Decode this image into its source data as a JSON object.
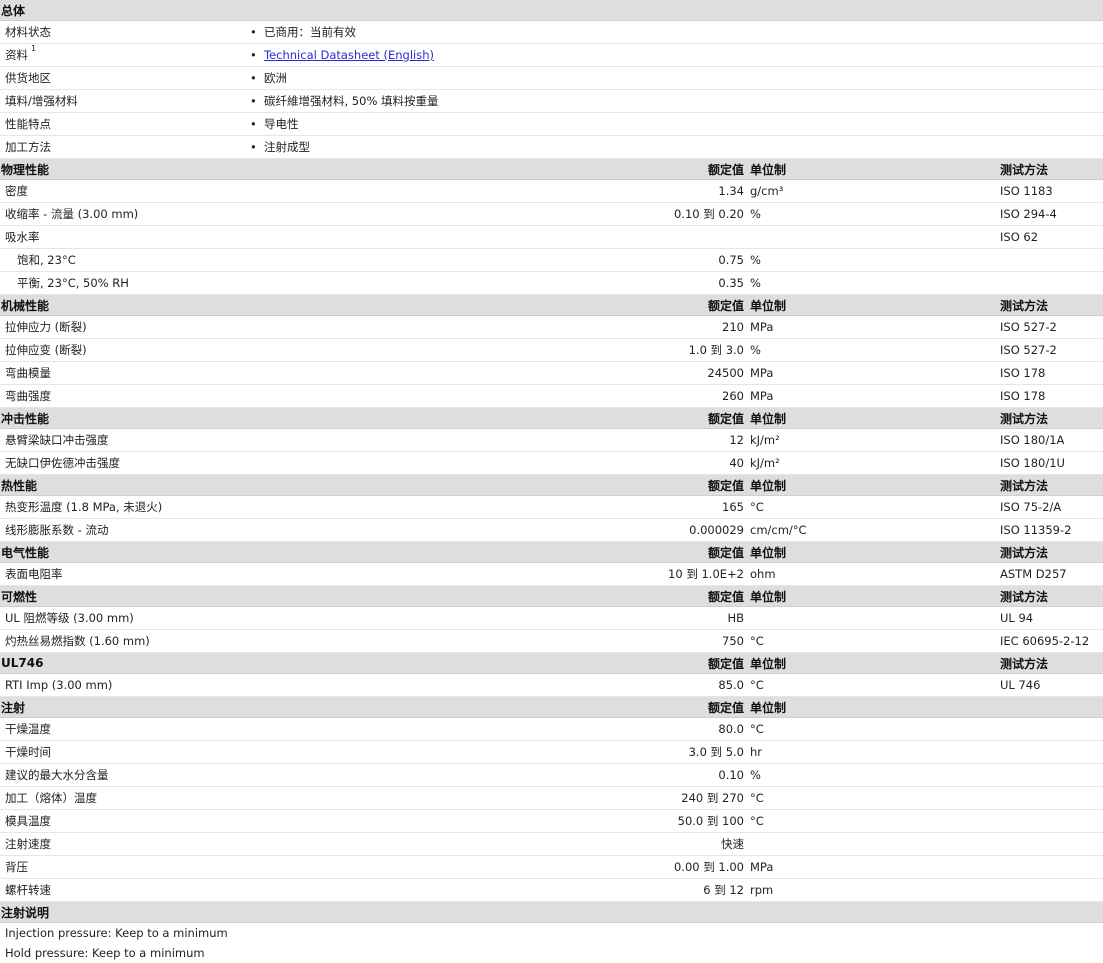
{
  "general": {
    "title": "总体",
    "rows": [
      {
        "label": "材料状态",
        "value": "已商用：当前有效"
      },
      {
        "label": "资料",
        "sup": "1",
        "value": "Technical Datasheet (English)",
        "link": true
      },
      {
        "label": "供货地区",
        "value": "欧洲"
      },
      {
        "label": "填料/增强材料",
        "value": "碳纤維增强材料, 50% 填料按重量"
      },
      {
        "label": "性能特点",
        "value": "导电性"
      },
      {
        "label": "加工方法",
        "value": "注射成型"
      }
    ],
    "bullet": "•"
  },
  "headers": {
    "nominal": "额定值",
    "unit": "单位制",
    "method": "测试方法"
  },
  "sections": [
    {
      "title": "物理性能",
      "show_method": true,
      "rows": [
        {
          "label": "密度",
          "value": "1.34",
          "unit": "g/cm³",
          "method": "ISO 1183"
        },
        {
          "label": "收缩率  - 流量  (3.00 mm)",
          "value": "0.10 到  0.20",
          "unit": "%",
          "method": "ISO 294-4"
        },
        {
          "label": "吸水率",
          "value": "",
          "unit": "",
          "method": "ISO 62"
        },
        {
          "label": "饱和, 23°C",
          "sub": true,
          "value": "0.75",
          "unit": "%",
          "method": ""
        },
        {
          "label": "平衡, 23°C, 50% RH",
          "sub": true,
          "value": "0.35",
          "unit": "%",
          "method": ""
        }
      ]
    },
    {
      "title": "机械性能",
      "show_method": true,
      "rows": [
        {
          "label": "拉伸应力  (断裂)",
          "value": "210",
          "unit": "MPa",
          "method": "ISO 527-2"
        },
        {
          "label": "拉伸应变  (断裂)",
          "value": "1.0 到  3.0",
          "unit": "%",
          "method": "ISO 527-2"
        },
        {
          "label": "弯曲模量",
          "value": "24500",
          "unit": "MPa",
          "method": "ISO 178"
        },
        {
          "label": "弯曲强度",
          "value": "260",
          "unit": "MPa",
          "method": "ISO 178"
        }
      ]
    },
    {
      "title": "冲击性能",
      "show_method": true,
      "rows": [
        {
          "label": "悬臂梁缺口冲击强度",
          "value": "12",
          "unit": "kJ/m²",
          "method": "ISO 180/1A"
        },
        {
          "label": "无缺口伊佐德冲击强度",
          "value": "40",
          "unit": "kJ/m²",
          "method": "ISO 180/1U"
        }
      ]
    },
    {
      "title": "热性能",
      "show_method": true,
      "rows": [
        {
          "label": "热变形温度  (1.8 MPa, 未退火)",
          "value": "165",
          "unit": "°C",
          "method": "ISO 75-2/A"
        },
        {
          "label": "线形膨胀系数  - 流动",
          "value": "0.000029",
          "unit": "cm/cm/°C",
          "method": "ISO 11359-2"
        }
      ]
    },
    {
      "title": "电气性能",
      "show_method": true,
      "rows": [
        {
          "label": "表面电阻率",
          "value": "10 到  1.0E+2",
          "unit": "ohm",
          "method": "ASTM D257"
        }
      ]
    },
    {
      "title": "可燃性",
      "show_method": true,
      "rows": [
        {
          "label": "UL 阻燃等级  (3.00 mm)",
          "value": "HB",
          "unit": "",
          "method": "UL 94"
        },
        {
          "label": "灼热丝易燃指数  (1.60 mm)",
          "value": "750",
          "unit": "°C",
          "method": "IEC 60695-2-12"
        }
      ]
    },
    {
      "title": "UL746",
      "show_method": true,
      "rows": [
        {
          "label": "RTI Imp (3.00 mm)",
          "value": "85.0",
          "unit": "°C",
          "method": "UL 746"
        }
      ]
    },
    {
      "title": "注射",
      "show_method": false,
      "rows": [
        {
          "label": "干燥温度",
          "value": "80.0",
          "unit": "°C",
          "method": ""
        },
        {
          "label": "干燥时间",
          "value": "3.0 到  5.0",
          "unit": "hr",
          "method": ""
        },
        {
          "label": "建议的最大水分含量",
          "value": "0.10",
          "unit": "%",
          "method": ""
        },
        {
          "label": "加工（熔体）温度",
          "value": "240 到  270",
          "unit": "°C",
          "method": ""
        },
        {
          "label": "模具温度",
          "value": "50.0 到  100",
          "unit": "°C",
          "method": ""
        },
        {
          "label": "注射速度",
          "value": "快速",
          "unit": "",
          "method": ""
        },
        {
          "label": "背压",
          "value": "0.00 到  1.00",
          "unit": "MPa",
          "method": ""
        },
        {
          "label": "螺杆转速",
          "value": "6 到  12",
          "unit": "rpm",
          "method": ""
        }
      ]
    }
  ],
  "notes": {
    "title": "注射说明",
    "lines": [
      "Injection pressure: Keep to a minimum",
      "Hold pressure: Keep to a minimum"
    ]
  }
}
